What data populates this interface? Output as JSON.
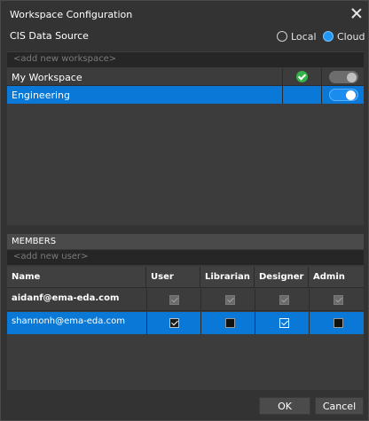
{
  "window": {
    "title": "Workspace Configuration"
  },
  "data_source": {
    "label": "CIS Data Source",
    "options": [
      {
        "label": "Local",
        "selected": false
      },
      {
        "label": "Cloud",
        "selected": true
      }
    ]
  },
  "workspaces": {
    "add_placeholder": "<add new workspace>",
    "rows": [
      {
        "name": "My Workspace",
        "default": true,
        "enabled": false,
        "selected": false
      },
      {
        "name": "Engineering",
        "default": false,
        "enabled": true,
        "selected": true
      }
    ]
  },
  "members": {
    "header": "MEMBERS",
    "add_placeholder": "<add new user>",
    "columns": [
      "Name",
      "User",
      "Librarian",
      "Designer",
      "Admin"
    ],
    "rows": [
      {
        "email": "aidanf@ema-eda.com",
        "user": "checked-disabled",
        "librarian": "checked-disabled",
        "designer": "checked-disabled",
        "admin": "checked-disabled",
        "selected": false
      },
      {
        "email": "shannonh@ema-eda.com",
        "user": "checked",
        "librarian": "unchecked",
        "designer": "checked",
        "admin": "unchecked",
        "selected": true
      }
    ]
  },
  "buttons": {
    "ok": "OK",
    "cancel": "Cancel"
  },
  "colors": {
    "accent": "#0a78d6",
    "success": "#35b34a",
    "background": "#333333"
  }
}
